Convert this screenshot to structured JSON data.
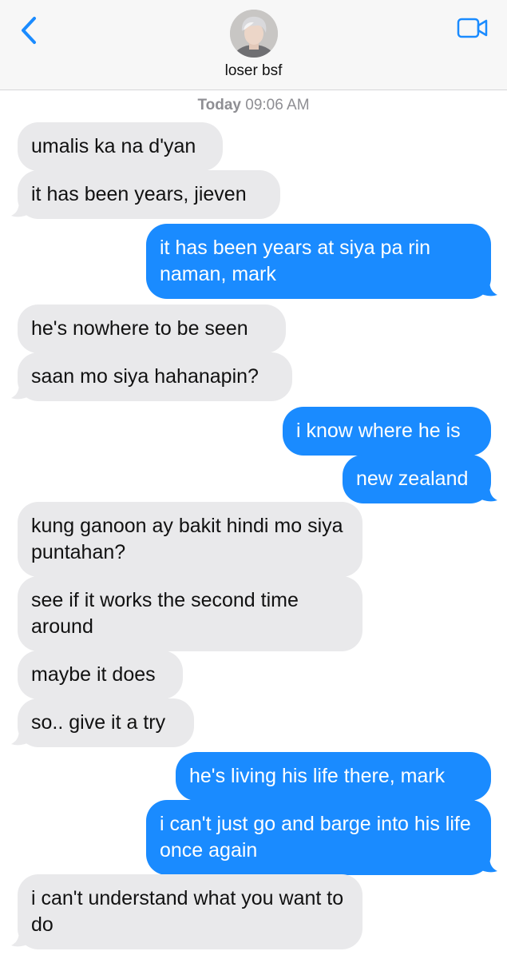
{
  "header": {
    "contact_name": "loser bsf",
    "back_icon": "chevron-left-icon",
    "video_icon": "video-camera-icon",
    "accent_color": "#1a8bff"
  },
  "timestamp": {
    "day": "Today",
    "time": "09:06 AM"
  },
  "messages": [
    {
      "direction": "in",
      "text": "umalis ka na d'yan"
    },
    {
      "direction": "in",
      "text": "it has been years, jieven"
    },
    {
      "direction": "out",
      "text": "it has been years at siya pa rin naman, mark"
    },
    {
      "direction": "in",
      "text": "he's nowhere to be seen"
    },
    {
      "direction": "in",
      "text": "saan mo siya hahanapin?"
    },
    {
      "direction": "out",
      "text": "i know where he is"
    },
    {
      "direction": "out",
      "text": "new zealand"
    },
    {
      "direction": "in",
      "text": "kung ganoon ay bakit hindi mo siya puntahan?"
    },
    {
      "direction": "in",
      "text": "see if it works the second time around"
    },
    {
      "direction": "in",
      "text": "maybe it does"
    },
    {
      "direction": "in",
      "text": "so.. give it a try"
    },
    {
      "direction": "out",
      "text": "he's living his life there, mark"
    },
    {
      "direction": "out",
      "text": "i can't just go and barge into his life once again"
    },
    {
      "direction": "in",
      "text": "i can't understand what you want to do"
    }
  ]
}
